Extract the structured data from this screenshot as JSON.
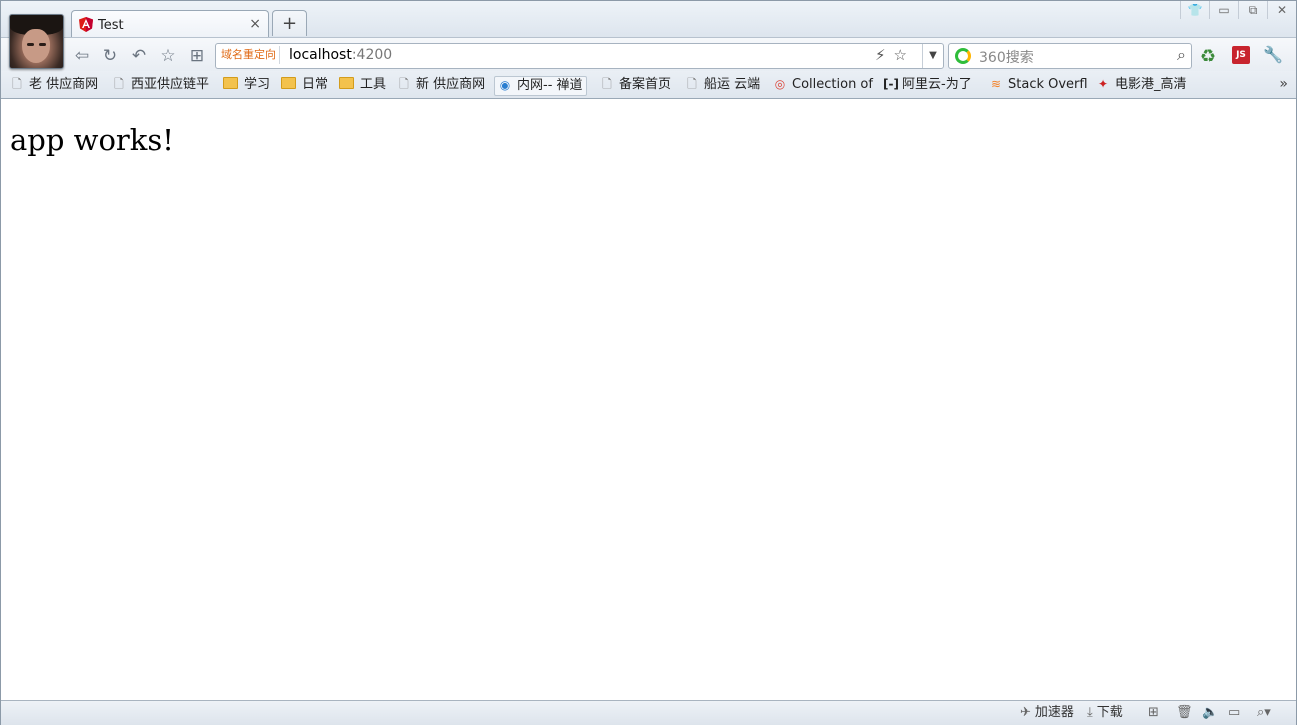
{
  "tab": {
    "title": "Test",
    "close": "×"
  },
  "newtab": "+",
  "window": {
    "skin": "👕",
    "min": "▭",
    "max": "⧉",
    "close": "✕"
  },
  "nav": {
    "back": "⇦",
    "refresh": "↻",
    "undo": "↶",
    "favorite": "☆",
    "apps": "⊞"
  },
  "address": {
    "redirect_label": "域名重定向",
    "host": "localhost",
    "port": ":4200",
    "lightning": "⚡",
    "star": "☆",
    "dropdown": "▼"
  },
  "search": {
    "placeholder": "360搜索",
    "icon": "⌕"
  },
  "extensions": {
    "recycle": "♻",
    "js": "JS",
    "tools": "🔧"
  },
  "bookmarks": [
    {
      "label": "老 供应商网",
      "icon": "page"
    },
    {
      "label": "西亚供应链平",
      "icon": "page"
    },
    {
      "label": "学习",
      "icon": "folder"
    },
    {
      "label": "日常",
      "icon": "folder"
    },
    {
      "label": "工具",
      "icon": "folder"
    },
    {
      "label": "新 供应商网",
      "icon": "page"
    },
    {
      "label": "内网-- 禅道",
      "icon": "globe"
    },
    {
      "label": "备案首页",
      "icon": "page"
    },
    {
      "label": "船运 云端",
      "icon": "page"
    },
    {
      "label": "Collection of",
      "icon": "chrome"
    },
    {
      "label": "阿里云-为了",
      "icon": "aliyun"
    },
    {
      "label": "Stack Overfl",
      "icon": "stackoverflow"
    },
    {
      "label": "电影港_高清",
      "icon": "film"
    }
  ],
  "bookmarks_more": "»",
  "content": {
    "heading": "app works!"
  },
  "status": {
    "accelerator": "加速器",
    "download": "下载"
  }
}
